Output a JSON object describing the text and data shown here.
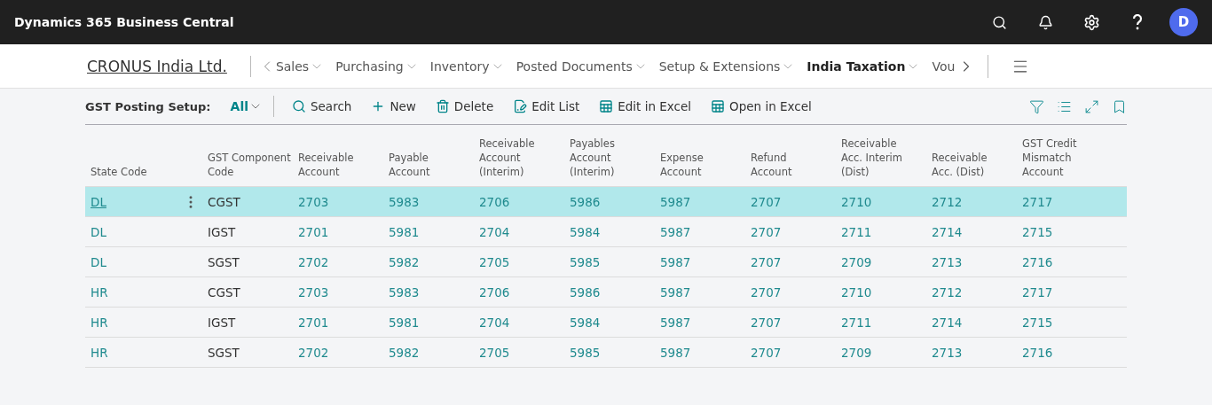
{
  "app_bar": {
    "title": "Dynamics 365 Business Central",
    "avatar": "D"
  },
  "nav": {
    "company": "CRONUS India Ltd.",
    "items": [
      {
        "label": "Sales",
        "selected": false,
        "menu": true
      },
      {
        "label": "Purchasing",
        "selected": false,
        "menu": true
      },
      {
        "label": "Inventory",
        "selected": false,
        "menu": true
      },
      {
        "label": "Posted Documents",
        "selected": false,
        "menu": true
      },
      {
        "label": "Setup & Extensions",
        "selected": false,
        "menu": true
      },
      {
        "label": "India Taxation",
        "selected": true,
        "menu": true
      },
      {
        "label": "Vou",
        "selected": false,
        "menu": false
      }
    ]
  },
  "action_bar": {
    "page_title": "GST Posting Setup:",
    "filter": "All",
    "actions": [
      {
        "kind": "search",
        "label": "Search"
      },
      {
        "kind": "new",
        "label": "New"
      },
      {
        "kind": "delete",
        "label": "Delete"
      },
      {
        "kind": "edit-list",
        "label": "Edit List"
      },
      {
        "kind": "excel",
        "label": "Edit in Excel"
      },
      {
        "kind": "excel",
        "label": "Open in Excel"
      }
    ]
  },
  "table": {
    "columns": [
      "State Code",
      "GST Component\nCode",
      "Receivable\nAccount",
      "Payable\nAccount",
      "Receivable\nAccount\n(Interim)",
      "Payables\nAccount\n(Interim)",
      "Expense\nAccount",
      "Refund\nAccount",
      "Receivable\nAcc. Interim\n(Dist)",
      "Receivable\nAcc. (Dist)",
      "GST Credit\nMismatch\nAccount"
    ],
    "rows": [
      {
        "selected": true,
        "cells": [
          "DL",
          "CGST",
          "2703",
          "5983",
          "2706",
          "5986",
          "5987",
          "2707",
          "2710",
          "2712",
          "2717"
        ]
      },
      {
        "selected": false,
        "cells": [
          "DL",
          "IGST",
          "2701",
          "5981",
          "2704",
          "5984",
          "5987",
          "2707",
          "2711",
          "2714",
          "2715"
        ]
      },
      {
        "selected": false,
        "cells": [
          "DL",
          "SGST",
          "2702",
          "5982",
          "2705",
          "5985",
          "5987",
          "2707",
          "2709",
          "2713",
          "2716"
        ]
      },
      {
        "selected": false,
        "cells": [
          "HR",
          "CGST",
          "2703",
          "5983",
          "2706",
          "5986",
          "5987",
          "2707",
          "2710",
          "2712",
          "2717"
        ]
      },
      {
        "selected": false,
        "cells": [
          "HR",
          "IGST",
          "2701",
          "5981",
          "2704",
          "5984",
          "5987",
          "2707",
          "2711",
          "2714",
          "2715"
        ]
      },
      {
        "selected": false,
        "cells": [
          "HR",
          "SGST",
          "2702",
          "5982",
          "2705",
          "5985",
          "5987",
          "2707",
          "2709",
          "2713",
          "2716"
        ]
      }
    ]
  }
}
